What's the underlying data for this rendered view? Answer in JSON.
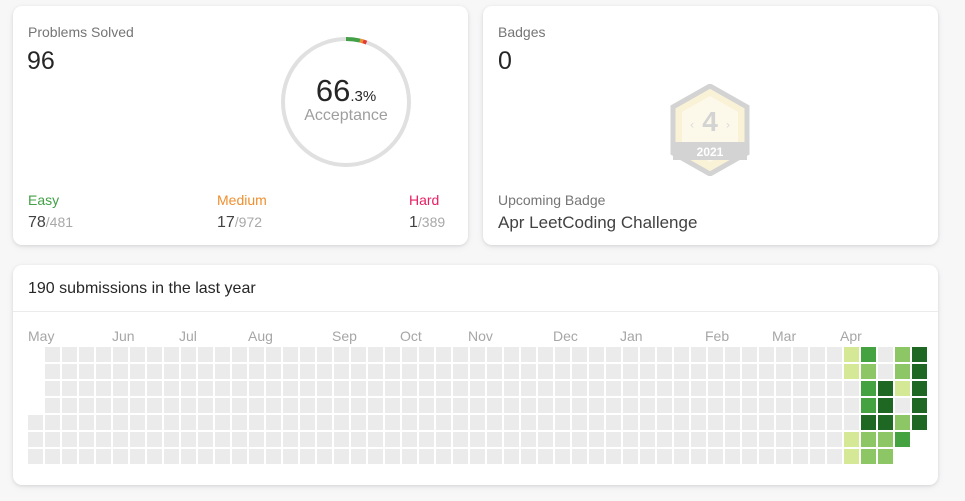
{
  "solved": {
    "title": "Problems Solved",
    "count": "96",
    "acceptance_int": "66",
    "acceptance_dec": ".3%",
    "acceptance_label": "Acceptance",
    "easy": {
      "label": "Easy",
      "solved": "78",
      "total": "/481",
      "color": "#43a047"
    },
    "medium": {
      "label": "Medium",
      "solved": "17",
      "total": "/972",
      "color": "#ef8f2f"
    },
    "hard": {
      "label": "Hard",
      "solved": "1",
      "total": "/389",
      "color": "#e91e63"
    }
  },
  "badges": {
    "title": "Badges",
    "count": "0",
    "badge_number": "4",
    "badge_year": "2021",
    "upcoming_label": "Upcoming Badge",
    "upcoming_name": "Apr LeetCoding Challenge"
  },
  "submissions": {
    "title": "190 submissions in the last year",
    "months": [
      "May",
      "Jun",
      "Jul",
      "Aug",
      "Sep",
      "Oct",
      "Nov",
      "Dec",
      "Jan",
      "Feb",
      "Mar",
      "Apr"
    ],
    "levels_recent": [
      [
        1,
        1,
        0,
        0,
        0,
        1,
        1
      ],
      [
        3,
        2,
        3,
        3,
        4,
        2,
        2
      ],
      [
        0,
        0,
        4,
        4,
        4,
        2,
        2
      ],
      [
        2,
        2,
        1,
        0,
        2,
        3,
        0
      ],
      [
        4,
        4,
        4,
        4,
        4,
        0,
        0
      ]
    ],
    "level_colors": [
      "#ebebeb",
      "#d4e896",
      "#8cc665",
      "#44a340",
      "#1e6823"
    ]
  }
}
